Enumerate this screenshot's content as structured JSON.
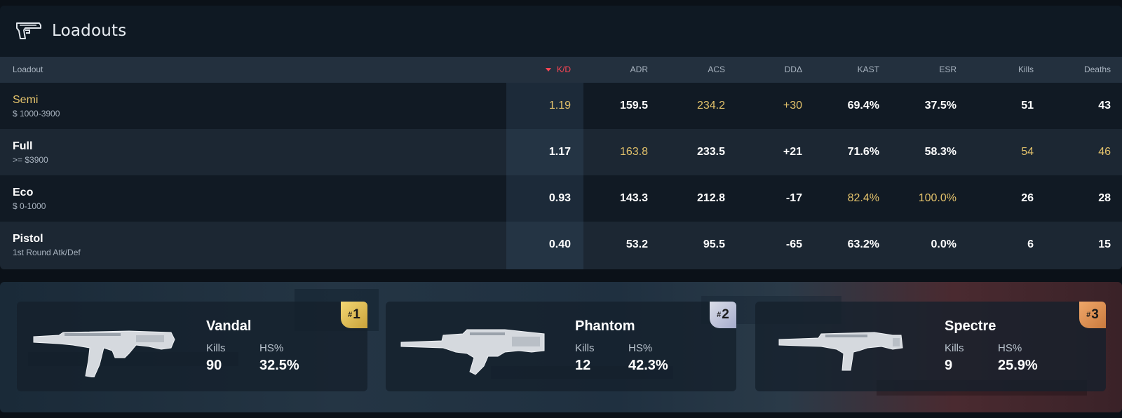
{
  "header": {
    "title": "Loadouts",
    "icon": "pistol-icon"
  },
  "table": {
    "columns": [
      "Loadout",
      "K/D",
      "ADR",
      "ACS",
      "DDΔ",
      "KAST",
      "ESR",
      "Kills",
      "Deaths"
    ],
    "sorted_column": "K/D",
    "sort_direction": "descending",
    "rows": [
      {
        "name": "Semi",
        "sub": "$ 1000-3900",
        "kd": "1.19",
        "adr": "159.5",
        "acs": "234.2",
        "dda": "+30",
        "kast": "69.4%",
        "esr": "37.5%",
        "kills": "51",
        "deaths": "43"
      },
      {
        "name": "Full",
        "sub": ">= $3900",
        "kd": "1.17",
        "adr": "163.8",
        "acs": "233.5",
        "dda": "+21",
        "kast": "71.6%",
        "esr": "58.3%",
        "kills": "54",
        "deaths": "46"
      },
      {
        "name": "Eco",
        "sub": "$ 0-1000",
        "kd": "0.93",
        "adr": "143.3",
        "acs": "212.8",
        "dda": "-17",
        "kast": "82.4%",
        "esr": "100.0%",
        "kills": "26",
        "deaths": "28"
      },
      {
        "name": "Pistol",
        "sub": "1st Round Atk/Def",
        "kd": "0.40",
        "adr": "53.2",
        "acs": "95.5",
        "dda": "-65",
        "kast": "63.2%",
        "esr": "0.0%",
        "kills": "6",
        "deaths": "15"
      }
    ]
  },
  "weapons": {
    "kills_label": "Kills",
    "hs_label": "HS%",
    "items": [
      {
        "rank": "1",
        "name": "Vandal",
        "kills": "90",
        "hs": "32.5%",
        "icon": "vandal-rifle-icon"
      },
      {
        "rank": "2",
        "name": "Phantom",
        "kills": "12",
        "hs": "42.3%",
        "icon": "phantom-rifle-icon"
      },
      {
        "rank": "3",
        "name": "Spectre",
        "kills": "9",
        "hs": "25.9%",
        "icon": "spectre-smg-icon"
      }
    ]
  },
  "colors": {
    "highlight": "#e3c26b",
    "sort_accent": "#ff4655",
    "panel": "#0f1923"
  }
}
